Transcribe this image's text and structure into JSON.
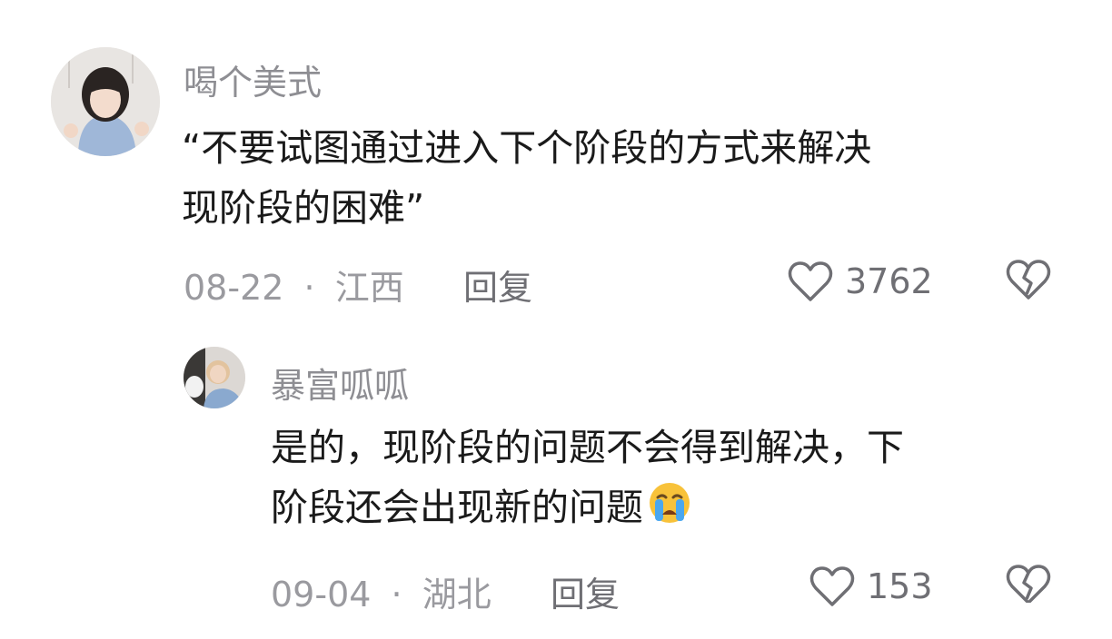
{
  "comments": [
    {
      "username": "喝个美式",
      "content_lines": [
        "“不要试图通过进入下个阶段的方式来解决",
        "现阶段的困难”"
      ],
      "date": "08-22",
      "location": "江西",
      "separator": "·",
      "reply_label": "回复",
      "like_count": "3762"
    },
    {
      "username": "暴富呱呱",
      "content_lines": [
        "是的，现阶段的问题不会得到解决，下",
        "阶段还会出现新的问题"
      ],
      "emoji": "loudly-crying-face",
      "date": "09-04",
      "location": "湖北",
      "separator": "·",
      "reply_label": "回复",
      "like_count": "153"
    }
  ],
  "colors": {
    "username": "#8e8e93",
    "text": "#1a1a1a",
    "meta": "#9a9a9f",
    "action": "#6f6f74"
  }
}
